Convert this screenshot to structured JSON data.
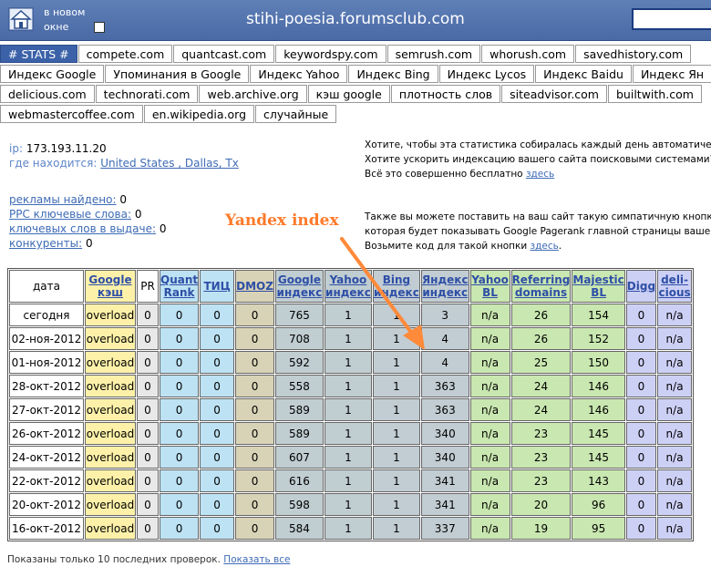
{
  "header": {
    "new_window_label": "в новом окне",
    "site_title": "stihi-poesia.forumsclub.com"
  },
  "tabs": [
    [
      "# STATS #",
      "compete.com",
      "quantcast.com",
      "keywordspy.com",
      "semrush.com",
      "whorush.com",
      "savedhistory.com"
    ],
    [
      "Индекс Google",
      "Упоминания в Google",
      "Индекс Yahoo",
      "Индекс Bing",
      "Индекс Lycos",
      "Индекс Baidu",
      "Индекс Ян"
    ],
    [
      "delicious.com",
      "technorati.com",
      "web.archive.org",
      "кэш google",
      "плотность слов",
      "siteadvisor.com",
      "builtwith.com"
    ],
    [
      "webmastercoffee.com",
      "en.wikipedia.org",
      "случайные"
    ]
  ],
  "info": {
    "ip_label": "ip:",
    "ip_value": "173.193.11.20",
    "location_label": "где находится:",
    "location_value": "United States , Dallas, Tx",
    "ads_label": "рекламы найдено:",
    "ads_value": "0",
    "ppc_label": "PPC ключевые слова:",
    "ppc_value": "0",
    "keywords_label": "ключевых слов в выдаче:",
    "keywords_value": "0",
    "competitors_label": "конкуренты:",
    "competitors_value": "0"
  },
  "promo1": {
    "line1": "Хотите, чтобы эта статистика собиралась каждый день автоматически?",
    "line2": "Хотите ускорить индексацию вашего сайта поисковыми системами?",
    "line3": "Всё это совершенно бесплатно",
    "link": "здесь"
  },
  "promo2": {
    "line1": "Также вы можете поставить на ваш сайт такую симпатичную кнопку ка",
    "line2": "которая будет показывать Google Pagerank главной страницы вашего са",
    "line3": "Возьмите код для такой кнопки",
    "link": "здесь"
  },
  "annotation": "Yandex index",
  "table": {
    "headers": [
      {
        "key": "date",
        "label": "дата"
      },
      {
        "key": "gk",
        "label": "Google кэш"
      },
      {
        "key": "pr",
        "label": "PR"
      },
      {
        "key": "qr",
        "label": "Quant Rank"
      },
      {
        "key": "tic",
        "label": "ТИЦ"
      },
      {
        "key": "dmoz",
        "label": "DMOZ"
      },
      {
        "key": "gi",
        "label": "Google индекс"
      },
      {
        "key": "yi",
        "label": "Yahoo индекс"
      },
      {
        "key": "bi",
        "label": "Bing индекс"
      },
      {
        "key": "ji",
        "label": "Яндекс индекс"
      },
      {
        "key": "ybl",
        "label": "Yahoo BL"
      },
      {
        "key": "ref",
        "label": "Referring domains"
      },
      {
        "key": "maj",
        "label": "Majestic BL"
      },
      {
        "key": "digg",
        "label": "Digg"
      },
      {
        "key": "del",
        "label": "deli- cious"
      }
    ],
    "rows": [
      [
        "сегодня",
        "overload",
        "0",
        "0",
        "0",
        "0",
        "765",
        "1",
        "1",
        "3",
        "n/a",
        "26",
        "154",
        "0",
        "n/a"
      ],
      [
        "02-ноя-2012",
        "overload",
        "0",
        "0",
        "0",
        "0",
        "708",
        "1",
        "1",
        "4",
        "n/a",
        "26",
        "152",
        "0",
        "n/a"
      ],
      [
        "01-ноя-2012",
        "overload",
        "0",
        "0",
        "0",
        "0",
        "592",
        "1",
        "1",
        "4",
        "n/a",
        "25",
        "150",
        "0",
        "n/a"
      ],
      [
        "28-окт-2012",
        "overload",
        "0",
        "0",
        "0",
        "0",
        "558",
        "1",
        "1",
        "363",
        "n/a",
        "24",
        "146",
        "0",
        "n/a"
      ],
      [
        "27-окт-2012",
        "overload",
        "0",
        "0",
        "0",
        "0",
        "589",
        "1",
        "1",
        "363",
        "n/a",
        "24",
        "146",
        "0",
        "n/a"
      ],
      [
        "26-окт-2012",
        "overload",
        "0",
        "0",
        "0",
        "0",
        "589",
        "1",
        "1",
        "340",
        "n/a",
        "23",
        "145",
        "0",
        "n/a"
      ],
      [
        "24-окт-2012",
        "overload",
        "0",
        "0",
        "0",
        "0",
        "607",
        "1",
        "1",
        "340",
        "n/a",
        "23",
        "145",
        "0",
        "n/a"
      ],
      [
        "22-окт-2012",
        "overload",
        "0",
        "0",
        "0",
        "0",
        "616",
        "1",
        "1",
        "341",
        "n/a",
        "23",
        "143",
        "0",
        "n/a"
      ],
      [
        "20-окт-2012",
        "overload",
        "0",
        "0",
        "0",
        "0",
        "598",
        "1",
        "1",
        "341",
        "n/a",
        "20",
        "96",
        "0",
        "n/a"
      ],
      [
        "16-окт-2012",
        "overload",
        "0",
        "0",
        "0",
        "0",
        "584",
        "1",
        "1",
        "337",
        "n/a",
        "19",
        "95",
        "0",
        "n/a"
      ]
    ]
  },
  "footer": {
    "text": "Показаны только 10 последних проверок.",
    "link": "Показать все"
  }
}
